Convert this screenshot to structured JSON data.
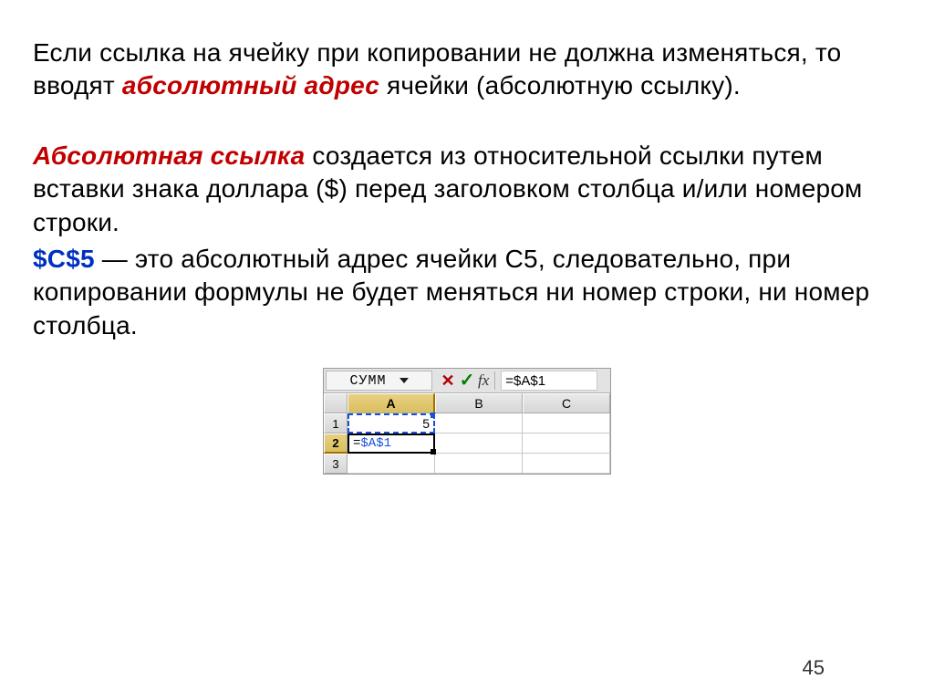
{
  "text": {
    "para1_pre": "Если ссылка на ячейку при копировании не должна изменяться, то вводят ",
    "para1_em": "абсолютный адрес",
    "para1_post": " ячейки (абсолютную ссылку).",
    "para2_em": "Абсолютная ссылка",
    "para2_post": " создается из относительной ссылки путем вставки знака доллара ($) перед заголовком столбца и/или номером строки.",
    "para3_em": "$C$5",
    "para3_post": " — это абсолютный адрес ячейки С5, следовательно, при копировании формулы не будет меняться ни номер строки, ни номер столбца."
  },
  "excel": {
    "namebox": "СУММ",
    "cancel_glyph": "✕",
    "confirm_glyph": "✓",
    "fx": "fx",
    "formula_bar": "=$A$1",
    "columns": [
      "A",
      "B",
      "C"
    ],
    "rows": [
      "1",
      "2",
      "3"
    ],
    "a1": "5",
    "a2_eq": "=",
    "a2_ref": "$A$1",
    "selected_col": 0,
    "selected_row": 1
  },
  "page_number": "45"
}
